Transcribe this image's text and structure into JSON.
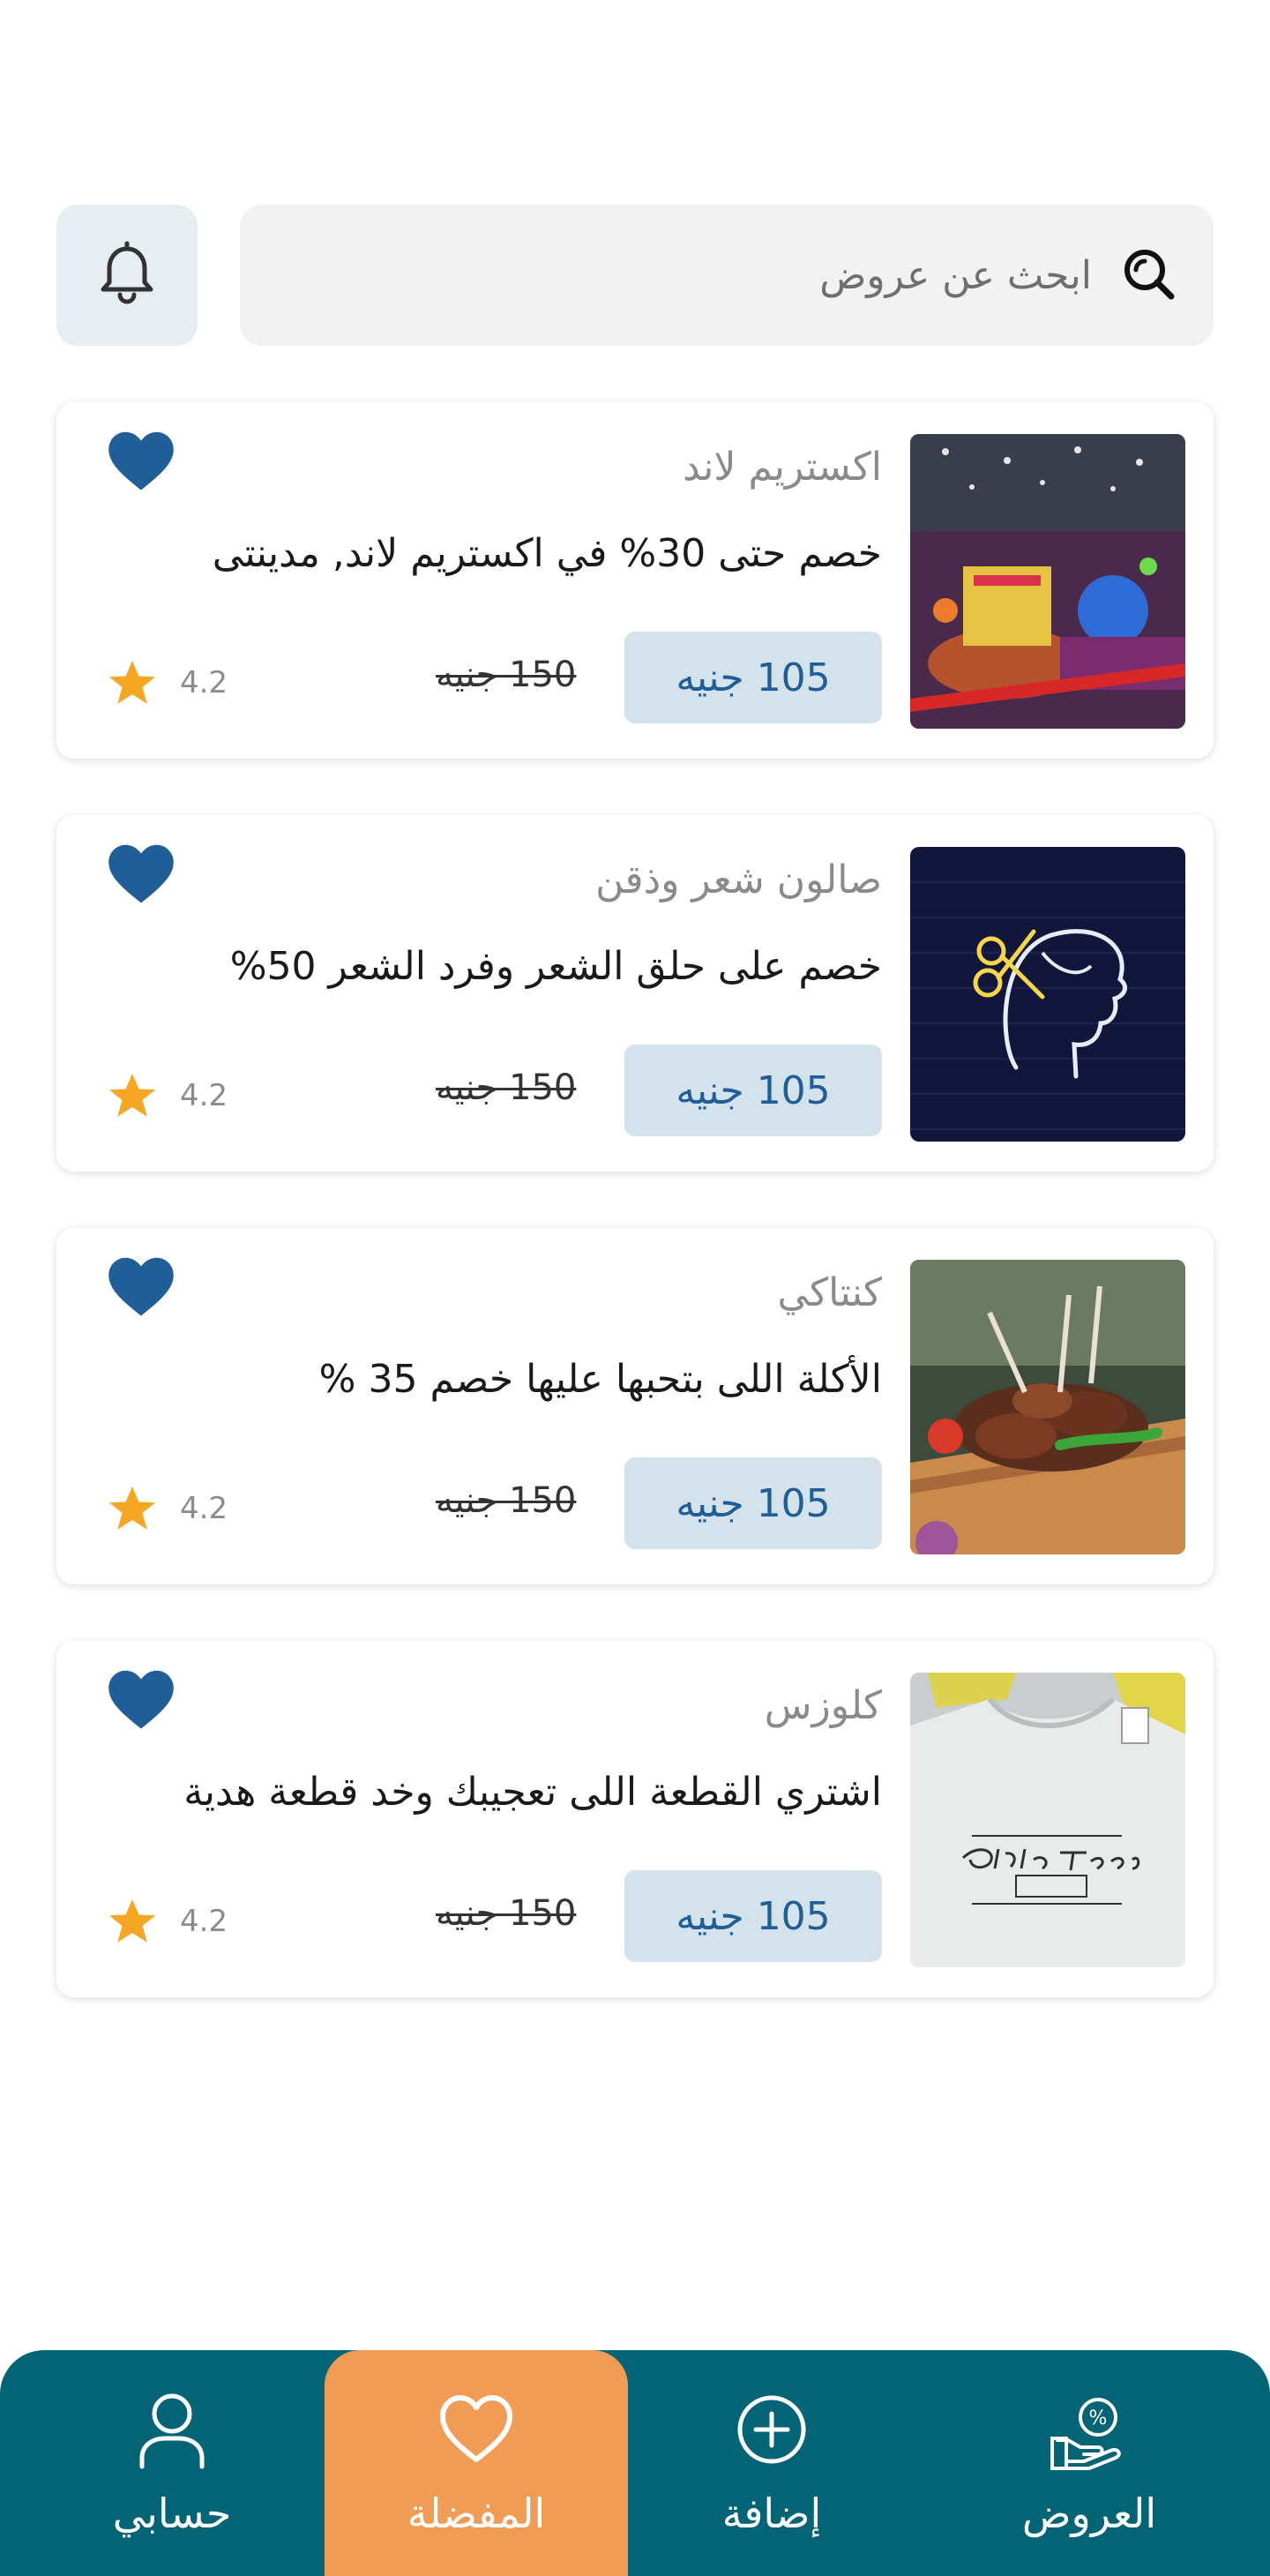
{
  "search": {
    "placeholder": "ابحث عن عروض"
  },
  "offers": [
    {
      "merchant": "اكستريم لاند",
      "title": "خصم حتى 30% في اكستريم لاند, مدينتى",
      "new_price": "105 جنيه",
      "old_price": "150 جنيه",
      "rating": "4.2",
      "image": "amusement-park-photo"
    },
    {
      "merchant": "صالون شعر وذقن",
      "title": "خصم على حلق الشعر وفرد الشعر 50%",
      "new_price": "105 جنيه",
      "old_price": "150 جنيه",
      "rating": "4.2",
      "image": "neon-barber-sign"
    },
    {
      "merchant": "كنتاكي",
      "title": "الأكلة اللى بتحبها عليها خصم 35 %",
      "new_price": "105 جنيه",
      "old_price": "150 جنيه",
      "rating": "4.2",
      "image": "grilled-meat-platter"
    },
    {
      "merchant": "كلوزس",
      "title": "اشتري القطعة اللى تعجيبك وخد قطعة هدية",
      "new_price": "105 جنيه",
      "old_price": "150 جنيه",
      "rating": "4.2",
      "image": "t-shirt-mockup"
    }
  ],
  "bottom_nav": {
    "items": [
      {
        "label": "العروض",
        "icon": "offers-hand-percent-icon",
        "active": false
      },
      {
        "label": "إضافة",
        "icon": "plus-circle-icon",
        "active": false
      },
      {
        "label": "المفضلة",
        "icon": "heart-icon",
        "active": true
      },
      {
        "label": "حسابي",
        "icon": "user-icon",
        "active": false
      }
    ]
  },
  "colors": {
    "primary": "#036475",
    "accent": "#f09c55",
    "heart": "#1f5e96",
    "star": "#f5a623",
    "price_chip": "#d4e2ec"
  }
}
